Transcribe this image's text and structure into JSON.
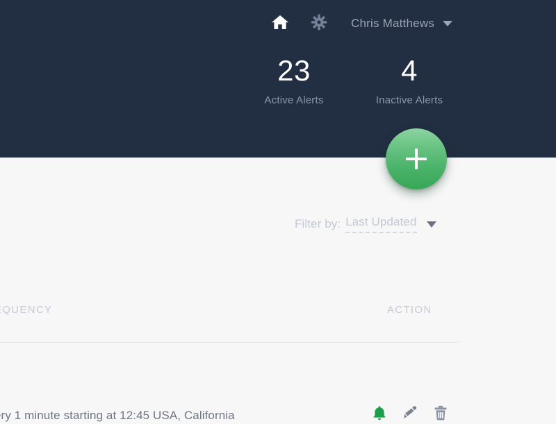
{
  "theme": {
    "header_bg": "#222e42",
    "body_bg": "#f7f7f8",
    "accent_green": "#37a755",
    "fab_green_light": "#8ed3a4",
    "muted_text": "#8d99aa",
    "row_text": "#6e7583",
    "header_label": "#c6cad4",
    "divider": "#e6e7ea"
  },
  "topbar": {
    "home_icon": "home-icon",
    "settings_icon": "gear-icon",
    "user_name": "Chris Matthews",
    "caret_icon": "chevron-down-icon"
  },
  "stats": [
    {
      "value": "23",
      "label": "Active Alerts"
    },
    {
      "value": "4",
      "label": "Inactive Alerts"
    }
  ],
  "fab": {
    "icon": "plus-icon",
    "label": "+"
  },
  "filter": {
    "label": "Filter by:",
    "value": "Last Updated",
    "caret_icon": "chevron-down-icon"
  },
  "table": {
    "columns": {
      "frequency": "EQUENCY",
      "action": "ACTION"
    },
    "rows": [
      {
        "frequency": "ery 1 minute starting at 12:45 USA, California",
        "actions": [
          {
            "name": "bell-icon",
            "title": "Notify"
          },
          {
            "name": "pencil-icon",
            "title": "Edit"
          },
          {
            "name": "trash-icon",
            "title": "Delete"
          }
        ]
      }
    ]
  }
}
